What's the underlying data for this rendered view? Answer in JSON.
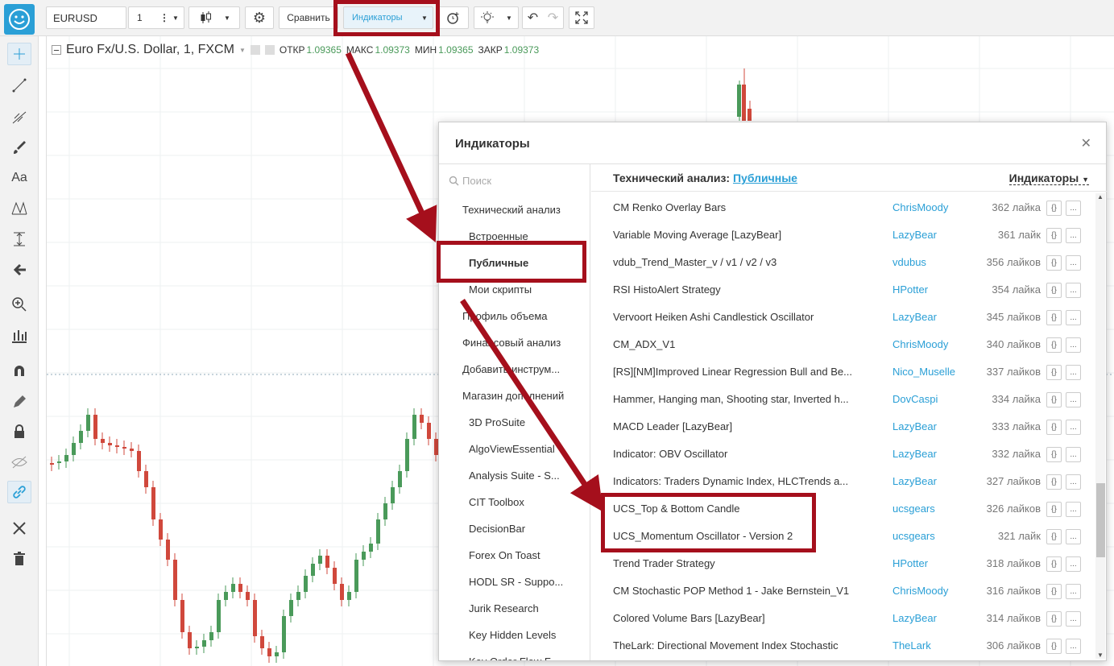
{
  "toolbar": {
    "symbol": "EURUSD",
    "interval": "1",
    "compare_label": "Сравнить",
    "indicators_label": "Индикаторы"
  },
  "chart": {
    "title": "Euro Fx/U.S. Dollar, 1, FXCM",
    "open_label": "ОТКР",
    "open_value": "1.09365",
    "high_label": "МАКС",
    "high_value": "1.09373",
    "low_label": "МИН",
    "low_value": "1.09365",
    "close_label": "ЗАКР",
    "close_value": "1.09373"
  },
  "dialog": {
    "title": "Индикаторы",
    "search_placeholder": "Поиск",
    "sidebar": [
      {
        "label": "Технический анализ",
        "group": true
      },
      {
        "label": "Встроенные"
      },
      {
        "label": "Публичные",
        "selected": true
      },
      {
        "label": "Мои скрипты"
      },
      {
        "label": "Профиль объема"
      },
      {
        "label": "Финансовый анализ"
      },
      {
        "label": "Добавить инструм..."
      },
      {
        "label": "Магазин дополнений",
        "group": true
      },
      {
        "label": "3D ProSuite"
      },
      {
        "label": "AlgoViewEssential"
      },
      {
        "label": "Analysis Suite - S..."
      },
      {
        "label": "CIT Toolbox"
      },
      {
        "label": "DecisionBar"
      },
      {
        "label": "Forex On Toast"
      },
      {
        "label": "HODL SR - Suppo..."
      },
      {
        "label": "Jurik Research"
      },
      {
        "label": "Key Hidden Levels"
      },
      {
        "label": "Key Order Flow F..."
      }
    ],
    "header_prefix": "Технический анализ:",
    "header_link": "Публичные",
    "header_right": "Индикаторы",
    "rows": [
      {
        "name": "CM Renko Overlay Bars",
        "author": "ChrisMoody",
        "likes": "362 лайка"
      },
      {
        "name": "Variable Moving Average [LazyBear]",
        "author": "LazyBear",
        "likes": "361 лайк"
      },
      {
        "name": "vdub_Trend_Master_v / v1 / v2 / v3",
        "author": "vdubus",
        "likes": "356 лайков"
      },
      {
        "name": "RSI HistoAlert Strategy",
        "author": "HPotter",
        "likes": "354 лайка"
      },
      {
        "name": "Vervoort Heiken Ashi Candlestick Oscillator",
        "author": "LazyBear",
        "likes": "345 лайков"
      },
      {
        "name": "CM_ADX_V1",
        "author": "ChrisMoody",
        "likes": "340 лайков"
      },
      {
        "name": "[RS][NM]Improved Linear Regression Bull and Be...",
        "author": "Nico_Muselle",
        "likes": "337 лайков"
      },
      {
        "name": "Hammer, Hanging man, Shooting star, Inverted h...",
        "author": "DovCaspi",
        "likes": "334 лайка"
      },
      {
        "name": "MACD Leader [LazyBear]",
        "author": "LazyBear",
        "likes": "333 лайка"
      },
      {
        "name": "Indicator: OBV Oscillator",
        "author": "LazyBear",
        "likes": "332 лайка"
      },
      {
        "name": "Indicators: Traders Dynamic Index, HLCTrends a...",
        "author": "LazyBear",
        "likes": "327 лайков"
      },
      {
        "name": "UCS_Top & Bottom Candle",
        "author": "ucsgears",
        "likes": "326 лайков"
      },
      {
        "name": "UCS_Momentum Oscillator - Version 2",
        "author": "ucsgears",
        "likes": "321 лайк"
      },
      {
        "name": "Trend Trader Strategy",
        "author": "HPotter",
        "likes": "318 лайков"
      },
      {
        "name": "CM Stochastic POP Method 1 - Jake Bernstein_V1",
        "author": "ChrisMoody",
        "likes": "316 лайков"
      },
      {
        "name": "Colored Volume Bars [LazyBear]",
        "author": "LazyBear",
        "likes": "314 лайков"
      },
      {
        "name": "TheLark: Directional Movement Index Stochastic",
        "author": "TheLark",
        "likes": "306 лайков"
      }
    ],
    "code_button": "{}",
    "more_button": "..."
  },
  "colors": {
    "accent": "#2a9fd6",
    "up": "#4a9a5a",
    "down": "#d0483c",
    "highlight": "#a50f1c"
  }
}
